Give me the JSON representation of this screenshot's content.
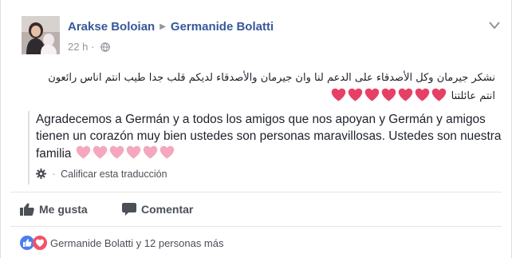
{
  "post": {
    "author": "Arakse Boloian",
    "target": "Germanide Bolatti",
    "time": "22 h",
    "time_sep": "·",
    "arabic_text": "نشكر جيرمان وكل الأصدقاء على الدعم لنا وان جيرمان والأصدقاء لديكم قلب جدا طيب انتم اناس رائعون انتم عائلتنا",
    "arabic_hearts": 7,
    "translation": "Agradecemos a Germán y a todos los amigos que nos apoyan y Germán y amigos tienen un corazón muy bien ustedes son personas maravillosas. Ustedes son nuestra familia",
    "translation_hearts": 6,
    "rate_dot": "·",
    "rate_label": "Calificar esta traducción"
  },
  "actions": {
    "like_label": "Me gusta",
    "comment_label": "Comentar"
  },
  "reactions": {
    "summary": "Germanide Bolatti y 12 personas más"
  },
  "colors": {
    "link": "#365899",
    "heart_red": "#e64066",
    "heart_pink": "#f4a7bd",
    "like_blue": "#4a7ef2",
    "love_red": "#f25268"
  }
}
